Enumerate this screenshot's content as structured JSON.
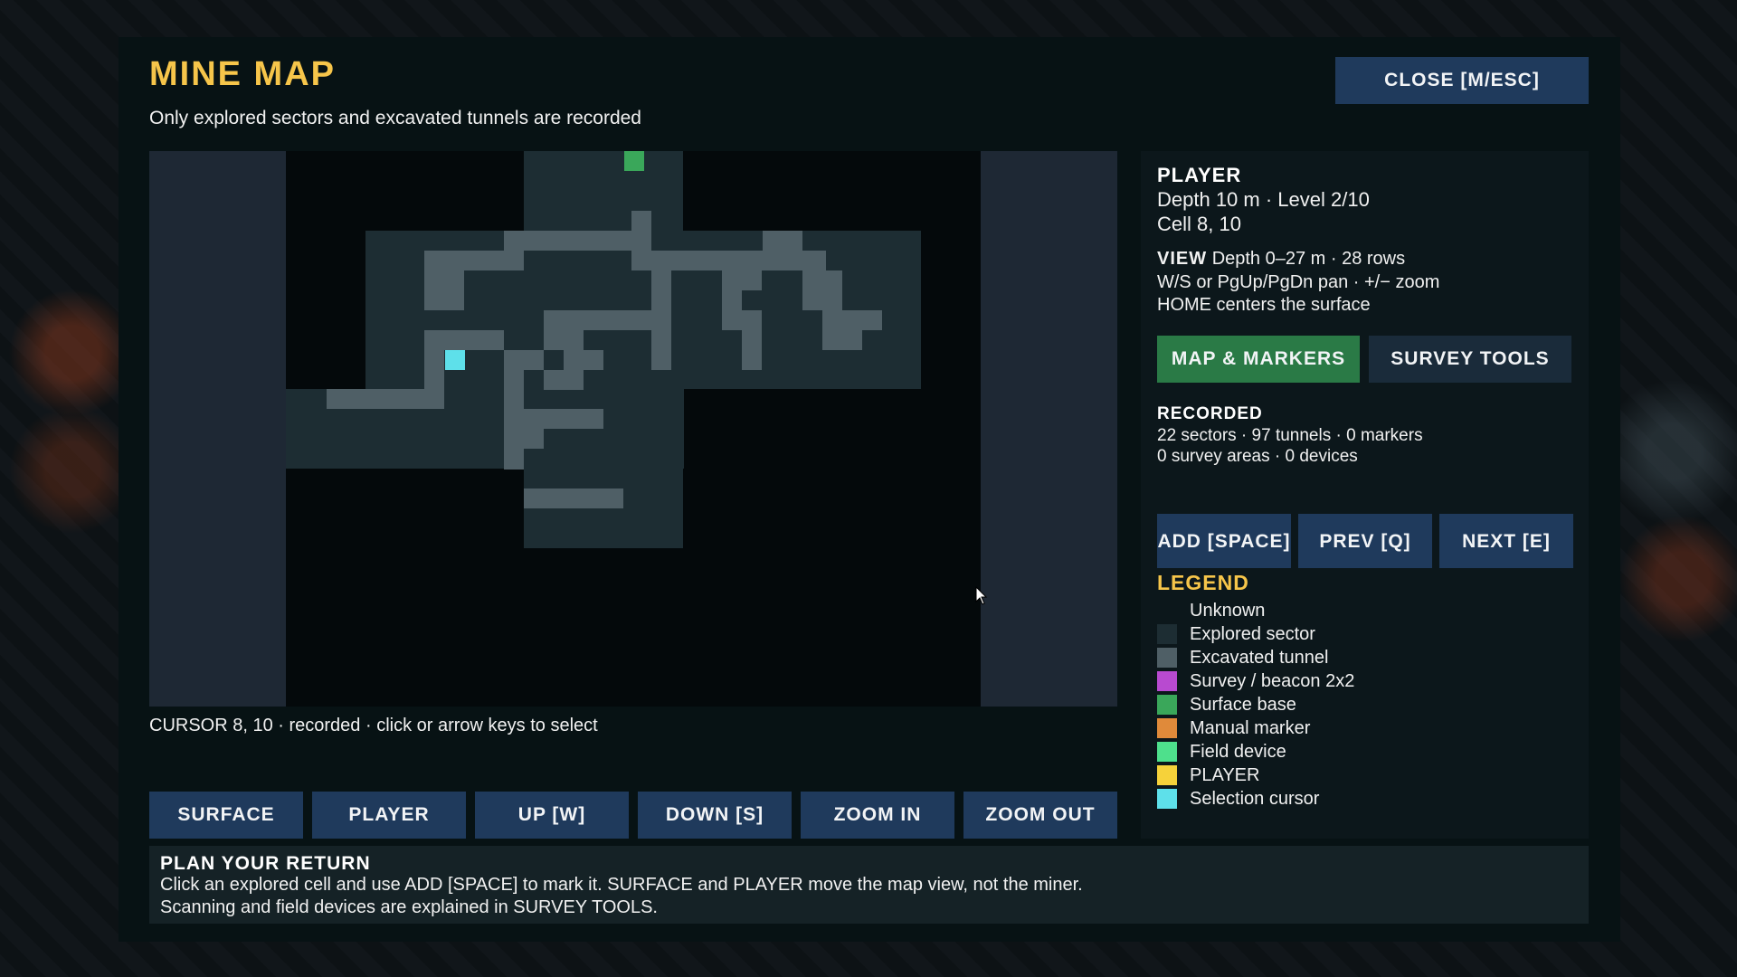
{
  "panel": {
    "title": "MINE MAP",
    "subtitle": "Only explored sectors and excavated tunnels are recorded",
    "close_label": "CLOSE [M/ESC]"
  },
  "map": {
    "cursor_text": "CURSOR 8, 10 · recorded · click or arrow keys to select",
    "buttons": {
      "surface": "SURFACE",
      "player": "PLAYER",
      "up": "UP [W]",
      "down": "DOWN [S]",
      "zoom_in": "ZOOM IN",
      "zoom_out": "ZOOM OUT"
    },
    "colors": {
      "unknown": "#04090b",
      "explored": "#1d2d33",
      "tunnel": "#4f5f66",
      "side_column": "#1e2834",
      "surface_base": "#3aa75a",
      "cursor": "#5ee0ea"
    }
  },
  "player": {
    "heading": "PLAYER",
    "depth_level": "Depth 10 m · Level 2/10",
    "cell": "Cell 8, 10"
  },
  "view": {
    "heading": "VIEW",
    "range": "Depth 0–27 m · 28 rows",
    "pan_hint": "W/S or PgUp/PgDn pan · +/− zoom",
    "home_hint": "HOME centers the surface"
  },
  "tabs": {
    "map_markers": "MAP & MARKERS",
    "survey_tools": "SURVEY TOOLS"
  },
  "recorded": {
    "heading": "RECORDED",
    "line1": "22 sectors · 97 tunnels · 0 markers",
    "line2": "0 survey areas · 0 devices"
  },
  "marker_buttons": {
    "add": "ADD [SPACE]",
    "prev": "PREV [Q]",
    "next": "NEXT [E]"
  },
  "legend": {
    "heading": "LEGEND",
    "items": [
      {
        "label": "Unknown",
        "color": "#0c171b"
      },
      {
        "label": "Explored sector",
        "color": "#1d2d33"
      },
      {
        "label": "Excavated tunnel",
        "color": "#4f5f66"
      },
      {
        "label": "Survey / beacon 2x2",
        "color": "#b84ad0"
      },
      {
        "label": "Surface base",
        "color": "#3aa75a"
      },
      {
        "label": "Manual marker",
        "color": "#e08a3a"
      },
      {
        "label": "Field device",
        "color": "#4ee08c"
      },
      {
        "label": "PLAYER",
        "color": "#f6d23a"
      },
      {
        "label": "Selection cursor",
        "color": "#5ee0ea"
      }
    ]
  },
  "plan": {
    "heading": "PLAN YOUR RETURN",
    "line1": "Click an explored cell and use ADD [SPACE] to mark it. SURFACE and PLAYER move the map view, not the miner.",
    "line2": "Scanning and field devices are explained in SURVEY TOOLS."
  }
}
